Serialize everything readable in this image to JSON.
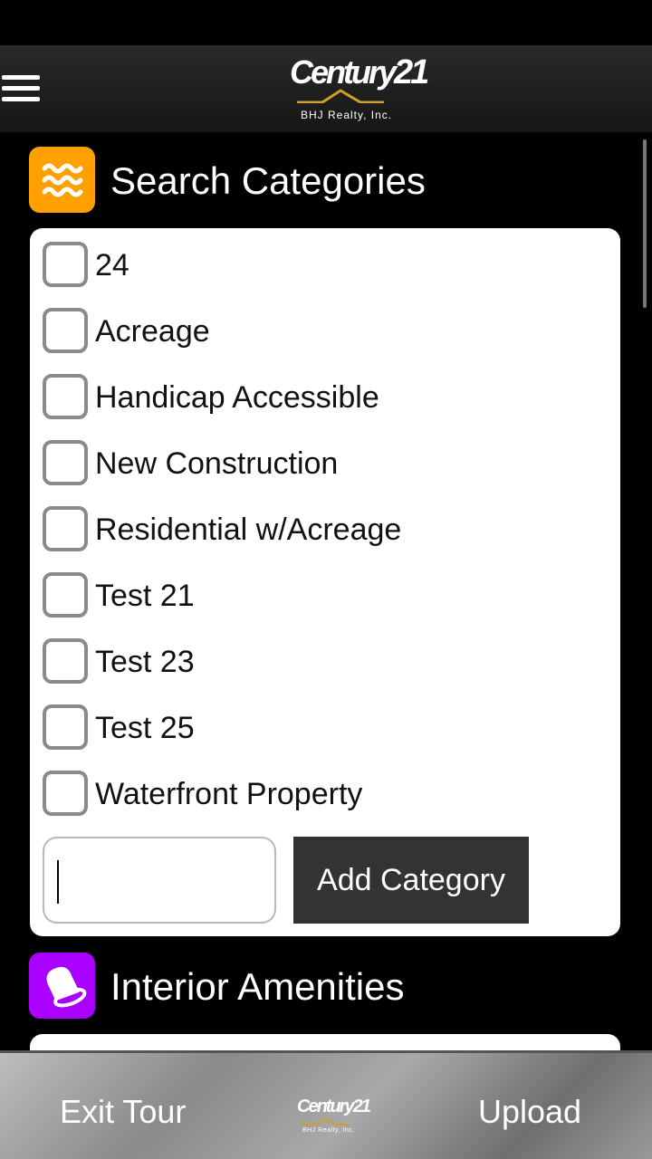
{
  "header": {
    "logo_brand": "Century",
    "logo_number": "21",
    "logo_subtitle": "BHJ Realty, Inc."
  },
  "search_categories": {
    "title": "Search Categories",
    "icon": "waves-icon",
    "icon_color": "#FFA000",
    "items": [
      {
        "label": "24",
        "checked": false
      },
      {
        "label": "Acreage",
        "checked": false
      },
      {
        "label": "Handicap Accessible",
        "checked": false
      },
      {
        "label": "New Construction",
        "checked": false
      },
      {
        "label": "Residential w/Acreage",
        "checked": false
      },
      {
        "label": "Test 21",
        "checked": false
      },
      {
        "label": "Test 23",
        "checked": false
      },
      {
        "label": "Test 25",
        "checked": false
      },
      {
        "label": "Waterfront Property",
        "checked": false
      }
    ],
    "input_value": "",
    "add_button_label": "Add Category"
  },
  "interior_amenities": {
    "title": "Interior Amenities",
    "icon": "bell-icon",
    "icon_color": "#AA00FF"
  },
  "bottom_bar": {
    "exit_label": "Exit Tour",
    "upload_label": "Upload",
    "logo_brand": "Century",
    "logo_number": "21",
    "logo_subtitle": "BHJ Realty, Inc."
  }
}
